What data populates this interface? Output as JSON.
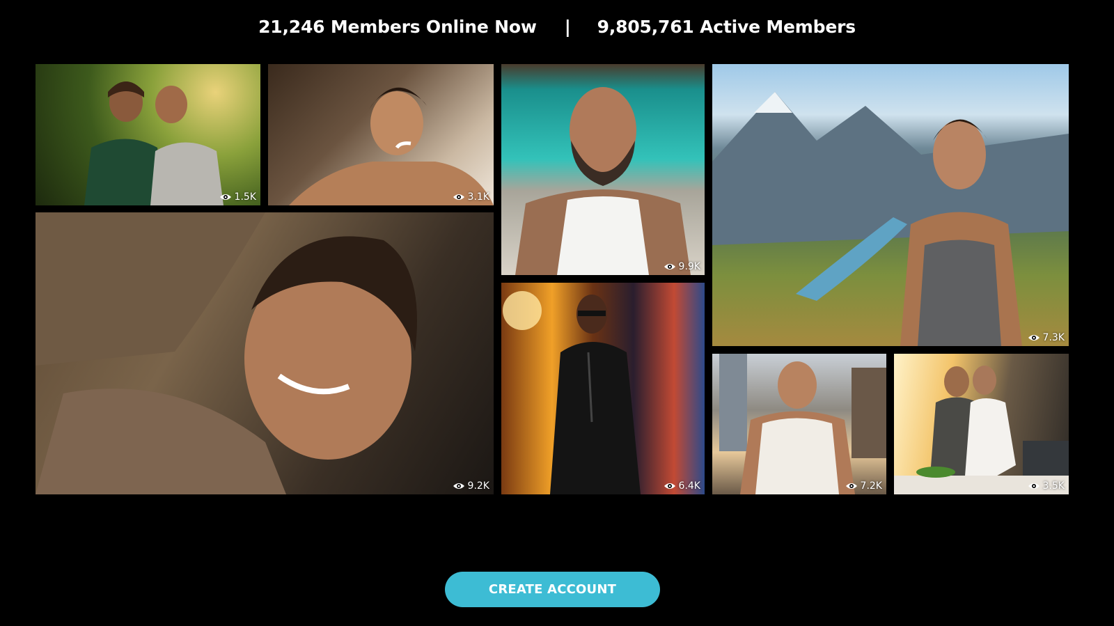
{
  "stats": {
    "online": "21,246 Members Online Now",
    "separator": "|",
    "active": "9,805,761 Active Members"
  },
  "gallery": {
    "tiles": [
      {
        "views": "1.5K"
      },
      {
        "views": "3.1K"
      },
      {
        "views": "9.9K"
      },
      {
        "views": "7.3K"
      },
      {
        "views": "9.2K"
      },
      {
        "views": "6.4K"
      },
      {
        "views": "7.2K"
      },
      {
        "views": "3.5K"
      }
    ]
  },
  "cta": {
    "label": "CREATE ACCOUNT",
    "color": "#3dbcd4"
  },
  "icons": {
    "views": "eye-icon"
  }
}
